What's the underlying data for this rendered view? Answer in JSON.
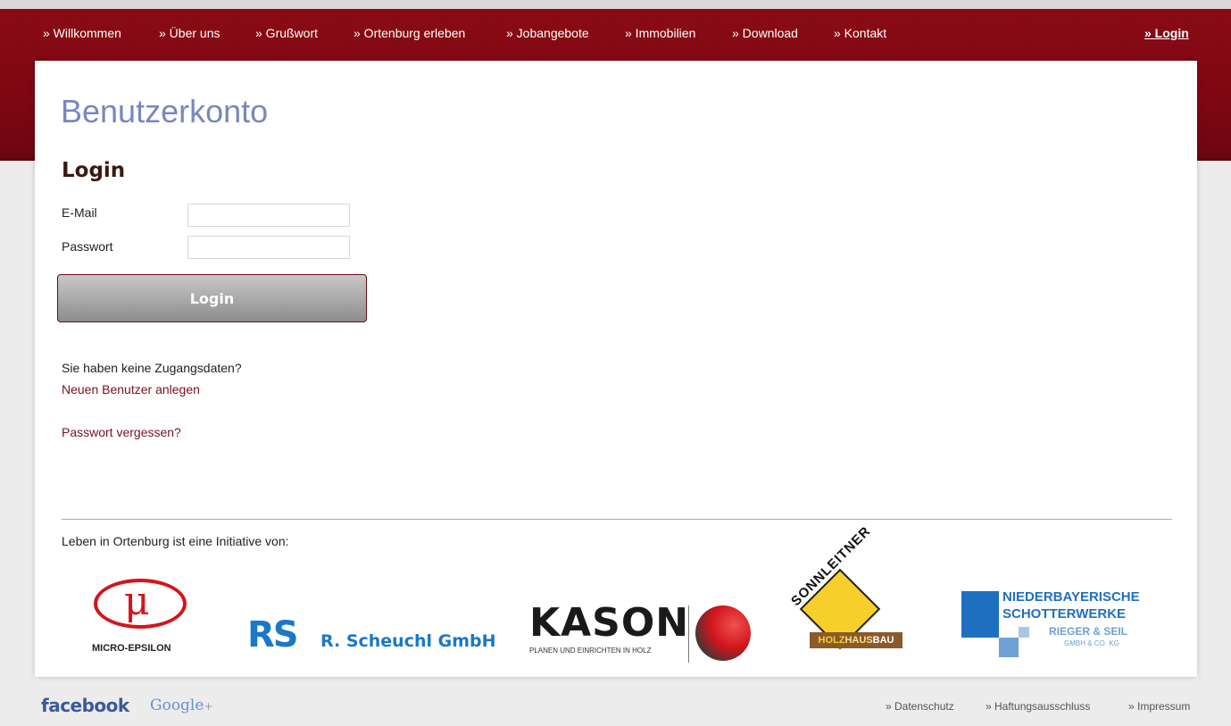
{
  "nav": {
    "items": [
      "» Willkommen",
      "» Über uns",
      "» Grußwort",
      "» Ortenburg erleben",
      "» Jobangebote",
      "» Immobilien",
      "» Download",
      "» Kontakt"
    ],
    "login": "» Login"
  },
  "page": {
    "title": "Benutzerkonto",
    "section_title": "Login"
  },
  "form": {
    "email_label": "E-Mail",
    "email_value": "",
    "password_label": "Passwort",
    "password_value": "",
    "submit_label": "Login"
  },
  "register": {
    "question": "Sie haben keine Zugangsdaten?",
    "link": "Neuen Benutzer anlegen"
  },
  "forgot_link": "Passwort vergessen?",
  "sponsors": {
    "intro": "Leben in Ortenburg ist eine Initiative von:",
    "micro_epsilon": {
      "mark": "μ",
      "name": "MICRO-EPSILON"
    },
    "scheuchl": {
      "mark": "RS",
      "name": "R. Scheuchl GmbH"
    },
    "kason": {
      "name": "KASON",
      "tagline": "PLANEN UND EINRICHTEN IN HOLZ"
    },
    "sonnleitner": {
      "name": "SONNLEITNER",
      "tagline_a": "HOLZ",
      "tagline_b": "HAUS",
      "tagline_c": "BAU"
    },
    "schotterwerke": {
      "line1": "NIEDERBAYERISCHE",
      "line2": "SCHOTTERWERKE",
      "line3": "RIEGER & SEIL",
      "line4": "GMBH & CO. KG"
    }
  },
  "footer": {
    "facebook": "facebook",
    "google": "Google",
    "google_plus": "+",
    "links": [
      "» Datenschutz",
      "» Haftungsausschluss",
      "» Impressum"
    ]
  },
  "colors": {
    "brand": "#7d0712",
    "title": "#7a86bc",
    "link": "#7a1020"
  }
}
